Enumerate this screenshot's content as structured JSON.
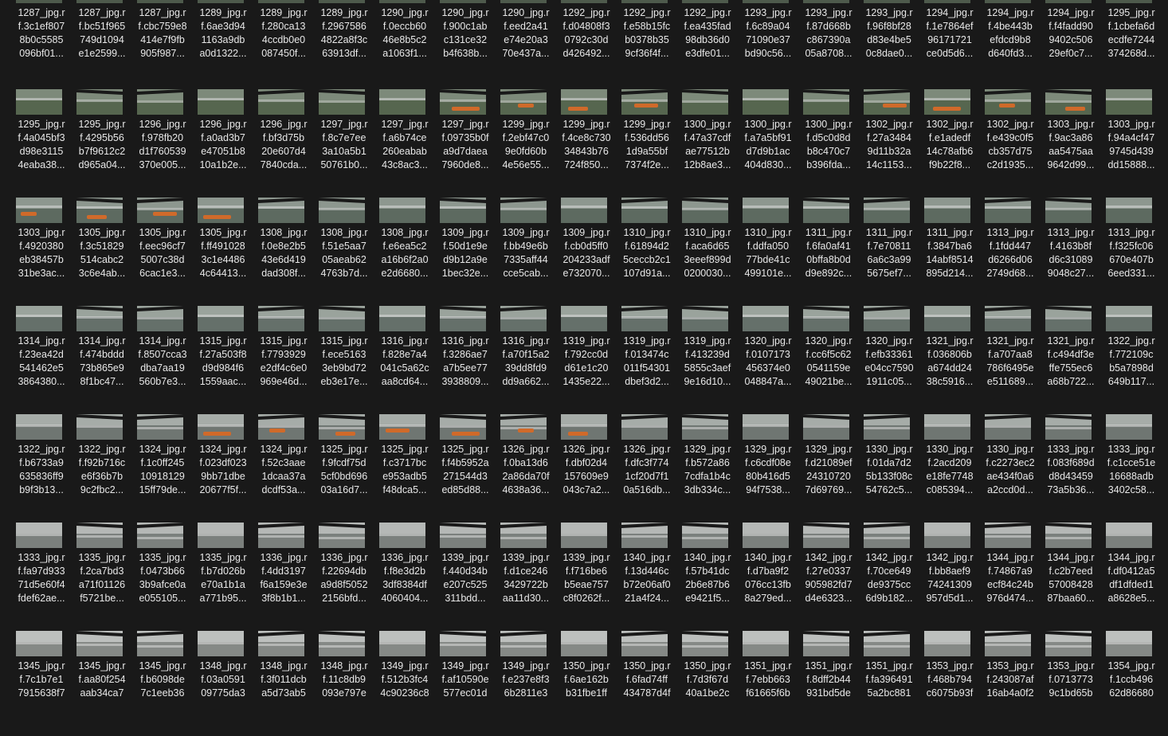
{
  "view": "file-explorer-large-icons",
  "icon": "image-thumbnail-icon",
  "rows": [
    [
      [
        "1287_jpg.r",
        "f.3c1ef807",
        "8b0c5585",
        "096bf01..."
      ],
      [
        "1287_jpg.r",
        "f.bc51f965",
        "749d1094",
        "e1e2599..."
      ],
      [
        "1287_jpg.r",
        "f.cbc759e8",
        "414e7f9fb",
        "905f987..."
      ],
      [
        "1289_jpg.r",
        "f.6ae3d94",
        "1163a9db",
        "a0d1322..."
      ],
      [
        "1289_jpg.r",
        "f.280ca13",
        "4ccdb0e0",
        "087450f..."
      ],
      [
        "1289_jpg.r",
        "f.2967586",
        "4822a8f3c",
        "63913df..."
      ],
      [
        "1290_jpg.r",
        "f.0eccb60",
        "46e8b5c2",
        "a1063f1..."
      ],
      [
        "1290_jpg.r",
        "f.900c1ab",
        "c131ce32",
        "b4f638b..."
      ],
      [
        "1290_jpg.r",
        "f.eed2a41",
        "e74e20a3",
        "70e437a..."
      ],
      [
        "1292_jpg.r",
        "f.d04808f3",
        "0792c30d",
        "d426492..."
      ],
      [
        "1292_jpg.r",
        "f.e58b15fc",
        "b0378b35",
        "9cf36f4f..."
      ],
      [
        "1292_jpg.r",
        "f.ea435fad",
        "98db36d0",
        "e3dfe01..."
      ],
      [
        "1293_jpg.r",
        "f.6c89a04",
        "71090e37",
        "bd90c56..."
      ],
      [
        "1293_jpg.r",
        "f.87d668b",
        "c867390a",
        "05a8708..."
      ],
      [
        "1293_jpg.r",
        "f.96f8bf28",
        "d83e4be5",
        "0c8dae0..."
      ],
      [
        "1294_jpg.r",
        "f.1e7864ef",
        "96171721",
        "ce0d5d6..."
      ],
      [
        "1294_jpg.r",
        "f.4be443b",
        "efdcd9b8",
        "d640fd3..."
      ],
      [
        "1294_jpg.r",
        "f.f4fadd90",
        "9402c506",
        "29ef0c7..."
      ],
      [
        "1295_jpg.r",
        "f.1cbefa6d",
        "ecdfe7244",
        "374268d..."
      ]
    ],
    [
      [
        "1295_jpg.r",
        "f.4a045bf3",
        "d98e3115",
        "4eaba38..."
      ],
      [
        "1295_jpg.r",
        "f.4295b56",
        "b7f9612c2",
        "d965a04..."
      ],
      [
        "1296_jpg.r",
        "f.978fb20",
        "d1f760539",
        "370e005..."
      ],
      [
        "1296_jpg.r",
        "f.a0ad3b7",
        "e47051b8",
        "10a1b2e..."
      ],
      [
        "1296_jpg.r",
        "f.bf3d75b",
        "20e607d4",
        "7840cda..."
      ],
      [
        "1297_jpg.r",
        "f.8c7e7ee",
        "3a10a5b1",
        "50761b0..."
      ],
      [
        "1297_jpg.r",
        "f.a6b74ce",
        "260eabab",
        "43c8ac3..."
      ],
      [
        "1297_jpg.r",
        "f.09735b0f",
        "a9d7daea",
        "7960de8..."
      ],
      [
        "1299_jpg.r",
        "f.2ebf47c0",
        "9e0fd60b",
        "4e56e55..."
      ],
      [
        "1299_jpg.r",
        "f.4ce8c730",
        "34843b76",
        "724f850..."
      ],
      [
        "1299_jpg.r",
        "f.536dd56",
        "1d9a55bf",
        "7374f2e..."
      ],
      [
        "1300_jpg.r",
        "f.47a37cdf",
        "ae77512b",
        "12b8ae3..."
      ],
      [
        "1300_jpg.r",
        "f.a7a5bf91",
        "d7d9b1ac",
        "404d830..."
      ],
      [
        "1300_jpg.r",
        "f.d5c0d8d",
        "b8c470c7",
        "b396fda..."
      ],
      [
        "1302_jpg.r",
        "f.27a3484",
        "9d11b32a",
        "14c1153..."
      ],
      [
        "1302_jpg.r",
        "f.e1adedf",
        "14c78afb6",
        "f9b22f8..."
      ],
      [
        "1302_jpg.r",
        "f.e439c0f5",
        "cb357d75",
        "c2d1935..."
      ],
      [
        "1303_jpg.r",
        "f.9ac3a86",
        "aa5475aa",
        "9642d99..."
      ],
      [
        "1303_jpg.r",
        "f.94a4cf47",
        "9745d439",
        "dd15888..."
      ]
    ],
    [
      [
        "1303_jpg.r",
        "f.4920380",
        "eb38457b",
        "31be3ac..."
      ],
      [
        "1305_jpg.r",
        "f.3c51829",
        "514cabc2",
        "3c6e4ab..."
      ],
      [
        "1305_jpg.r",
        "f.eec96cf7",
        "5007c38d",
        "6cac1e3..."
      ],
      [
        "1305_jpg.r",
        "f.ff491028",
        "3c1e4486",
        "4c64413..."
      ],
      [
        "1308_jpg.r",
        "f.0e8e2b5",
        "43e6d419",
        "dad308f..."
      ],
      [
        "1308_jpg.r",
        "f.51e5aa7",
        "05aeab62",
        "4763b7d..."
      ],
      [
        "1308_jpg.r",
        "f.e6ea5c2",
        "a16b6f2a0",
        "e2d6680..."
      ],
      [
        "1309_jpg.r",
        "f.50d1e9e",
        "d9b12a9e",
        "1bec32e..."
      ],
      [
        "1309_jpg.r",
        "f.bb49e6b",
        "7335aff44",
        "cce5cab..."
      ],
      [
        "1309_jpg.r",
        "f.cb0d5ff0",
        "204233adf",
        "e732070..."
      ],
      [
        "1310_jpg.r",
        "f.61894d2",
        "5ceccb2c1",
        "107d91a..."
      ],
      [
        "1310_jpg.r",
        "f.aca6d65",
        "3eeef899d",
        "0200030..."
      ],
      [
        "1310_jpg.r",
        "f.ddfa050",
        "77bde41c",
        "499101e..."
      ],
      [
        "1311_jpg.r",
        "f.6fa0af41",
        "0bffa8b0d",
        "d9e892c..."
      ],
      [
        "1311_jpg.r",
        "f.7e70811",
        "6a6c3a99",
        "5675ef7..."
      ],
      [
        "1311_jpg.r",
        "f.3847ba6",
        "14abf8514",
        "895d214..."
      ],
      [
        "1313_jpg.r",
        "f.1fdd447",
        "d6266d06",
        "2749d68..."
      ],
      [
        "1313_jpg.r",
        "f.4163b8f",
        "d6c31089",
        "9048c27..."
      ],
      [
        "1313_jpg.r",
        "f.f325fc06",
        "670e407b",
        "6eed331..."
      ]
    ],
    [
      [
        "1314_jpg.r",
        "f.23ea42d",
        "541462e5",
        "3864380..."
      ],
      [
        "1314_jpg.r",
        "f.474bddd",
        "73b865e9",
        "8f1bc47..."
      ],
      [
        "1314_jpg.r",
        "f.8507cca3",
        "dba7aa19",
        "560b7e3..."
      ],
      [
        "1315_jpg.r",
        "f.27a503f8",
        "d9d984f6",
        "1559aac..."
      ],
      [
        "1315_jpg.r",
        "f.7793929",
        "e2df4c6e0",
        "969e46d..."
      ],
      [
        "1315_jpg.r",
        "f.ece5163",
        "3eb9bd72",
        "eb3e17e..."
      ],
      [
        "1316_jpg.r",
        "f.828e7a4",
        "041c5a62c",
        "aa8cd64..."
      ],
      [
        "1316_jpg.r",
        "f.3286ae7",
        "a7b5ee77",
        "3938809..."
      ],
      [
        "1316_jpg.r",
        "f.a70f15a2",
        "39dd8fd9",
        "dd9a662..."
      ],
      [
        "1319_jpg.r",
        "f.792cc0d",
        "d61e1c20",
        "1435e22..."
      ],
      [
        "1319_jpg.r",
        "f.013474c",
        "011f54301",
        "dbef3d2..."
      ],
      [
        "1319_jpg.r",
        "f.413239d",
        "5855c3aef",
        "9e16d10..."
      ],
      [
        "1320_jpg.r",
        "f.0107173",
        "456374e0",
        "048847a..."
      ],
      [
        "1320_jpg.r",
        "f.cc6f5c62",
        "0541159e",
        "49021be..."
      ],
      [
        "1320_jpg.r",
        "f.efb33361",
        "e04cc7590",
        "1911c05..."
      ],
      [
        "1321_jpg.r",
        "f.036806b",
        "a674dd24",
        "38c5916..."
      ],
      [
        "1321_jpg.r",
        "f.a707aa8",
        "786f6495e",
        "e511689..."
      ],
      [
        "1321_jpg.r",
        "f.c494df3e",
        "ffe755ec6",
        "a68b722..."
      ],
      [
        "1322_jpg.r",
        "f.772109c",
        "b5a7898d",
        "649b117..."
      ]
    ],
    [
      [
        "1322_jpg.r",
        "f.b6733a9",
        "635836ff9",
        "b9f3b13..."
      ],
      [
        "1322_jpg.r",
        "f.f92b716c",
        "e6f36b7b",
        "9c2fbc2..."
      ],
      [
        "1324_jpg.r",
        "f.1c0ff245",
        "10918129",
        "15ff79de..."
      ],
      [
        "1324_jpg.r",
        "f.023df023",
        "9bb71dbe",
        "20677f5f..."
      ],
      [
        "1324_jpg.r",
        "f.52c3aae",
        "1dcaa37a",
        "dcdf53a..."
      ],
      [
        "1325_jpg.r",
        "f.9fcdf75d",
        "5cf0bd696",
        "03a16d7..."
      ],
      [
        "1325_jpg.r",
        "f.c3717bc",
        "e953adb5",
        "f48dca5..."
      ],
      [
        "1325_jpg.r",
        "f.f4b5952a",
        "271544d3",
        "ed85d88..."
      ],
      [
        "1326_jpg.r",
        "f.0ba13d6",
        "2a86da70f",
        "4638a36..."
      ],
      [
        "1326_jpg.r",
        "f.dbf02d4",
        "157609e9",
        "043c7a2..."
      ],
      [
        "1326_jpg.r",
        "f.dfc3f774",
        "1cf20d7f1",
        "0a516db..."
      ],
      [
        "1329_jpg.r",
        "f.b572a86",
        "7cdfa1b4c",
        "3db334c..."
      ],
      [
        "1329_jpg.r",
        "f.c6cdf08e",
        "80b416d5",
        "94f7538..."
      ],
      [
        "1329_jpg.r",
        "f.d21089ef",
        "24310720",
        "7d69769..."
      ],
      [
        "1330_jpg.r",
        "f.01da7d2",
        "5b133f08c",
        "54762c5..."
      ],
      [
        "1330_jpg.r",
        "f.2acd209",
        "e18fe7748",
        "c085394..."
      ],
      [
        "1330_jpg.r",
        "f.c2273ec2",
        "ae434f0a6",
        "a2ccd0d..."
      ],
      [
        "1333_jpg.r",
        "f.083f689d",
        "d8d43459",
        "73a5b36..."
      ],
      [
        "1333_jpg.r",
        "f.c1cce51e",
        "16688adb",
        "3402c58..."
      ]
    ],
    [
      [
        "1333_jpg.r",
        "f.fa97d933",
        "71d5e60f4",
        "fdef62ae..."
      ],
      [
        "1335_jpg.r",
        "f.2ca7bd3",
        "a71f01126",
        "f5721be..."
      ],
      [
        "1335_jpg.r",
        "f.0473b66",
        "3b9afce0a",
        "e055105..."
      ],
      [
        "1335_jpg.r",
        "f.b7d026b",
        "e70a1b1a",
        "a771b95..."
      ],
      [
        "1336_jpg.r",
        "f.4dd3197",
        "f6a159e3e",
        "3f8b1b1..."
      ],
      [
        "1336_jpg.r",
        "f.22694db",
        "a9d8f5052",
        "2156bfd..."
      ],
      [
        "1336_jpg.r",
        "f.f8e3d2b",
        "3df8384df",
        "4060404..."
      ],
      [
        "1339_jpg.r",
        "f.440d34b",
        "e207c525",
        "311bdd..."
      ],
      [
        "1339_jpg.r",
        "f.d1ce246",
        "3429722b",
        "aa11d30..."
      ],
      [
        "1339_jpg.r",
        "f.f716be6",
        "b5eae757",
        "c8f0262f..."
      ],
      [
        "1340_jpg.r",
        "f.13d446c",
        "b72e06af0",
        "21a4f24..."
      ],
      [
        "1340_jpg.r",
        "f.57b41dc",
        "2b6e87b6",
        "e9421f5..."
      ],
      [
        "1340_jpg.r",
        "f.d7ba9f2",
        "076cc13fb",
        "8a279ed..."
      ],
      [
        "1342_jpg.r",
        "f.27e0337",
        "905982fd7",
        "d4e6323..."
      ],
      [
        "1342_jpg.r",
        "f.70ce649",
        "de9375cc",
        "6d9b182..."
      ],
      [
        "1342_jpg.r",
        "f.bb8aef9",
        "74241309",
        "957d5d1..."
      ],
      [
        "1344_jpg.r",
        "f.74867a9",
        "ecf84c24b",
        "976d474..."
      ],
      [
        "1344_jpg.r",
        "f.c2b7eed",
        "57008428",
        "87baa60..."
      ],
      [
        "1344_jpg.r",
        "f.df0412a5",
        "df1dfded1",
        "a8628e5..."
      ]
    ],
    [
      [
        "1345_jpg.r",
        "f.7c1b7e1",
        "7915638f7"
      ],
      [
        "1345_jpg.r",
        "f.aa80f254",
        "aab34ca7"
      ],
      [
        "1345_jpg.r",
        "f.b6098de",
        "7c1eeb36"
      ],
      [
        "1348_jpg.r",
        "f.03a0591",
        "09775da3"
      ],
      [
        "1348_jpg.r",
        "f.3f011dcb",
        "a5d73ab5"
      ],
      [
        "1348_jpg.r",
        "f.11c8db9",
        "093e797e"
      ],
      [
        "1349_jpg.r",
        "f.512b3fc4",
        "4c90236c8"
      ],
      [
        "1349_jpg.r",
        "f.af10590e",
        "577ec01d"
      ],
      [
        "1349_jpg.r",
        "f.e237e8f3",
        "6b2811e3"
      ],
      [
        "1350_jpg.r",
        "f.6ae162b",
        "b31fbe1ff"
      ],
      [
        "1350_jpg.r",
        "f.6fad74ff",
        "434787d4f"
      ],
      [
        "1350_jpg.r",
        "f.7d3f67d",
        "40a1be2c"
      ],
      [
        "1351_jpg.r",
        "f.7ebb663",
        "f61665f6b"
      ],
      [
        "1351_jpg.r",
        "f.8dff2b44",
        "931bd5de"
      ],
      [
        "1351_jpg.r",
        "f.fa396491",
        "5a2bc881"
      ],
      [
        "1353_jpg.r",
        "f.468b794",
        "c6075b93f"
      ],
      [
        "1353_jpg.r",
        "f.243087af",
        "16ab4a0f2"
      ],
      [
        "1353_jpg.r",
        "f.0713773",
        "9c1bd65b"
      ],
      [
        "1354_jpg.r",
        "f.1ccb496",
        "62d86680"
      ]
    ]
  ]
}
